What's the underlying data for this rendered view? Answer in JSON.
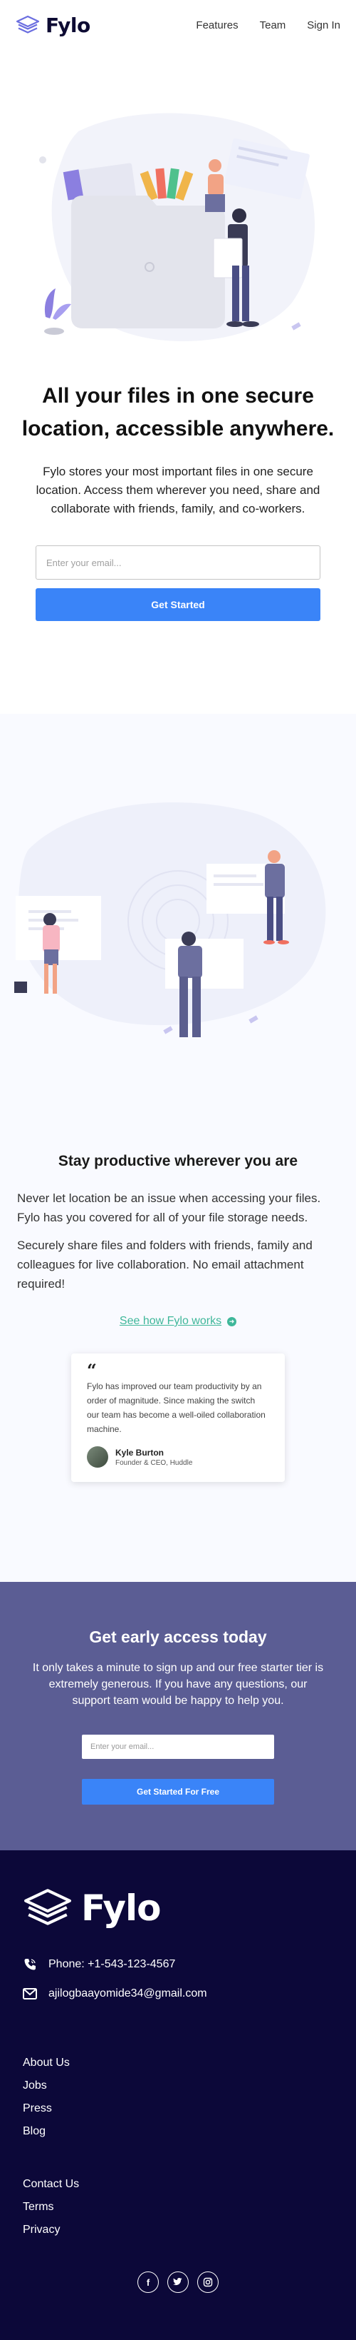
{
  "brand": {
    "name": "Fylo"
  },
  "nav": {
    "features": "Features",
    "team": "Team",
    "signin": "Sign In"
  },
  "hero": {
    "title": "All your files in one secure location, accessible anywhere.",
    "description": "Fylo stores your most important files in one secure location. Access them wherever you need, share and collaborate with friends, family, and co-workers.",
    "email_placeholder": "Enter your email...",
    "cta_label": "Get Started"
  },
  "productive": {
    "title": "Stay productive wherever you are",
    "paragraph1": "Never let location be an issue when accessing your files. Fylo has you covered for all of your file storage needs.",
    "paragraph2": "Securely share files and folders with friends, family and colleagues for live collaboration. No email attachment required!",
    "link_label": "See how Fylo works",
    "testimonial": {
      "quote": "Fylo has improved our team productivity by an order of magnitude. Since making the switch our team has become a well-oiled collaboration machine.",
      "name": "Kyle Burton",
      "role": "Founder & CEO, Huddle"
    }
  },
  "cta": {
    "title": "Get early access today",
    "description": "It only takes a minute to sign up and our free starter tier is extremely generous. If you have any questions, our support team would be happy to help you.",
    "email_placeholder": "Enter your email...",
    "button_label": "Get Started For Free"
  },
  "footer": {
    "phone": "Phone: +1-543-123-4567",
    "email": "ajilogbaayomide34@gmail.com",
    "links_group1": [
      "About Us",
      "Jobs",
      "Press",
      "Blog"
    ],
    "links_group2": [
      "Contact Us",
      "Terms",
      "Privacy"
    ],
    "socials": [
      "facebook-icon",
      "twitter-icon",
      "instagram-icon"
    ]
  },
  "colors": {
    "primary_blue": "#3a84f8",
    "accent_green": "#3fb79a",
    "cta_bg": "#5b5d94",
    "footer_bg": "#0c0839"
  }
}
